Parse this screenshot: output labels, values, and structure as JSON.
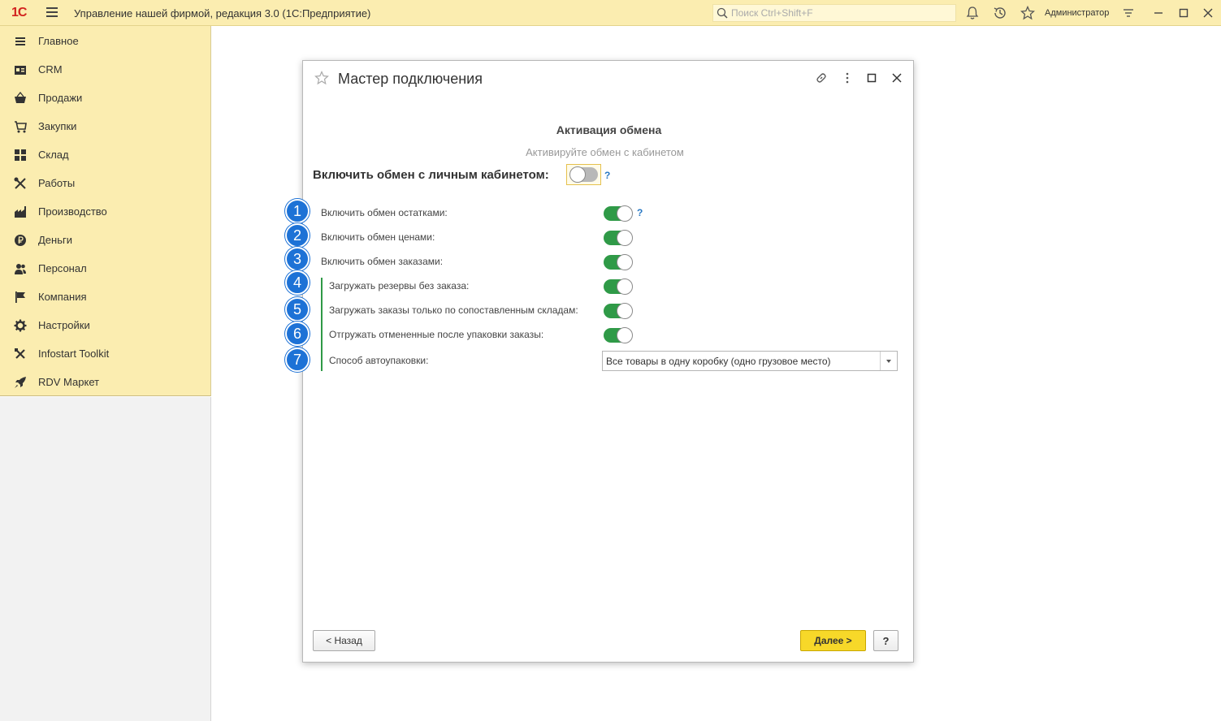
{
  "app": {
    "logo": "1С",
    "title": "Управление нашей фирмой, редакция 3.0  (1С:Предприятие)",
    "search_placeholder": "Поиск Ctrl+Shift+F",
    "user": "Администратор"
  },
  "sidebar": {
    "items": [
      {
        "label": "Главное",
        "icon": "menu-icon"
      },
      {
        "label": "CRM",
        "icon": "crm-icon"
      },
      {
        "label": "Продажи",
        "icon": "basket-icon"
      },
      {
        "label": "Закупки",
        "icon": "cart-icon"
      },
      {
        "label": "Склад",
        "icon": "grid-icon"
      },
      {
        "label": "Работы",
        "icon": "tools-icon"
      },
      {
        "label": "Производство",
        "icon": "factory-icon"
      },
      {
        "label": "Деньги",
        "icon": "ruble-icon"
      },
      {
        "label": "Персонал",
        "icon": "people-icon"
      },
      {
        "label": "Компания",
        "icon": "flag-icon"
      },
      {
        "label": "Настройки",
        "icon": "gear-icon"
      },
      {
        "label": "Infostart Toolkit",
        "icon": "wrench-icon"
      },
      {
        "label": "RDV Маркет",
        "icon": "rocket-icon"
      }
    ]
  },
  "dialog": {
    "title": "Мастер подключения",
    "step_title": "Активация обмена",
    "step_subtitle": "Активируйте обмен с кабинетом",
    "main_toggle_label": "Включить обмен с личным кабинетом:",
    "main_toggle_on": false,
    "help_mark": "?",
    "options": [
      {
        "badge": "1",
        "label": "Включить обмен остатками:",
        "on": true
      },
      {
        "badge": "2",
        "label": "Включить обмен ценами:",
        "on": true
      },
      {
        "badge": "3",
        "label": "Включить обмен заказами:",
        "on": true
      },
      {
        "badge": "4",
        "label": "Загружать резервы без заказа:",
        "on": true
      },
      {
        "badge": "5",
        "label": "Загружать заказы только по сопоставленным складам:",
        "on": true
      },
      {
        "badge": "6",
        "label": "Отгружать отмененные после упаковки заказы:",
        "on": true
      }
    ],
    "packing": {
      "badge": "7",
      "label": "Способ автоупаковки:",
      "value": "Все товары в одну коробку (одно грузовое место)"
    },
    "buttons": {
      "back": "< Назад",
      "next": "Далее >",
      "help": "?"
    }
  },
  "colors": {
    "toolbar_bg": "#fbedb0",
    "toggle_on": "#2f9a47",
    "badge": "#1d72d6",
    "primary_button": "#f7d829",
    "help_link": "#2a79c4"
  }
}
